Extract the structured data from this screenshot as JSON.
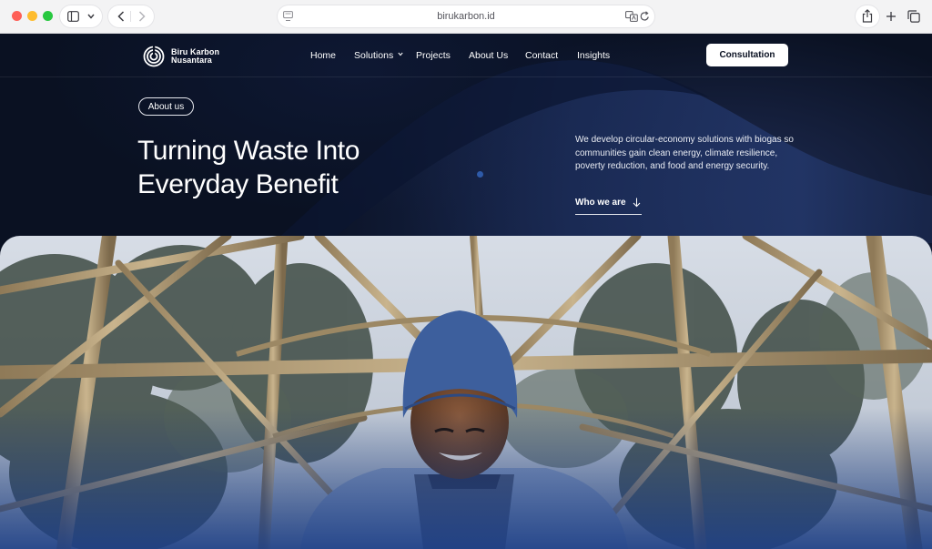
{
  "browser": {
    "url": "birukarbon.id",
    "icons": [
      "sidebar-icon",
      "chevron-down-icon",
      "back-icon",
      "forward-icon",
      "page-settings-icon",
      "translate-icon",
      "reload-icon",
      "share-icon",
      "new-tab-icon",
      "tabs-overview-icon"
    ]
  },
  "site": {
    "logo": {
      "line1": "Biru Karbon",
      "line2": "Nusantara"
    },
    "nav": {
      "home": "Home",
      "solutions": "Solutions",
      "projects": "Projects",
      "about": "About Us",
      "contact": "Contact",
      "insights": "Insights"
    },
    "cta": "Consultation"
  },
  "hero": {
    "tag": "About us",
    "headline_line1": "Turning Waste Into",
    "headline_line2": "Everyday Benefit",
    "description": "We develop circular-economy solutions with biogas so communities gain clean energy, climate resilience, poverty reduction, and food and energy security.",
    "link": "Who we are"
  },
  "colors": {
    "background": "#0a1122",
    "accent_blue": "#2e5aa8",
    "button_bg": "#ffffff"
  }
}
